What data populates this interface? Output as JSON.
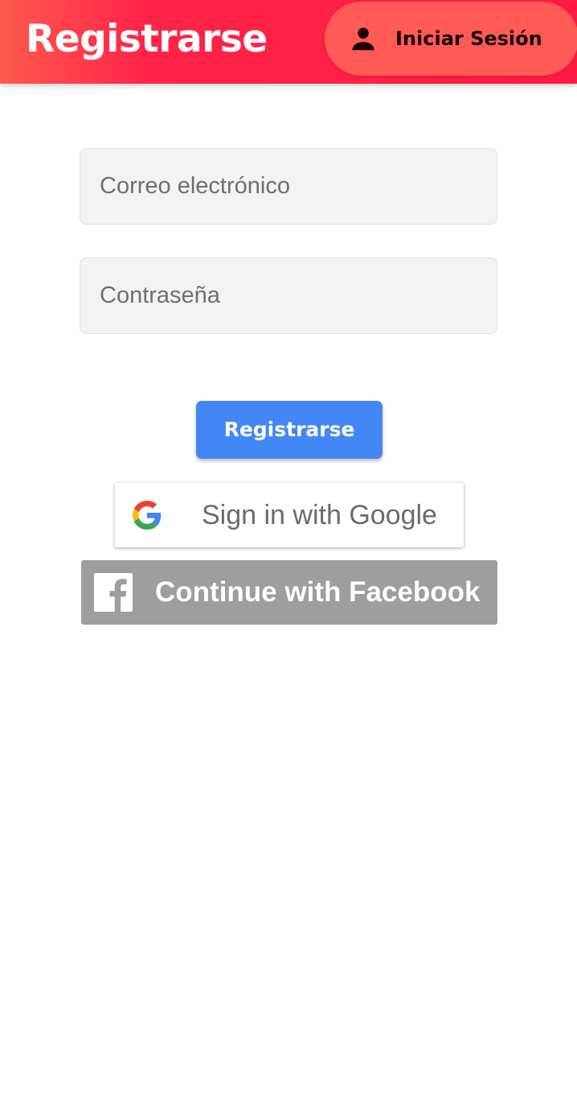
{
  "header": {
    "title": "Registrarse",
    "login_button": {
      "label": "Iniciar Sesión",
      "icon": "person-icon"
    }
  },
  "form": {
    "email": {
      "placeholder": "Correo electrónico",
      "value": ""
    },
    "password": {
      "placeholder": "Contraseña",
      "value": ""
    },
    "register_button_label": "Registrarse"
  },
  "social": {
    "google": {
      "label": "Sign in with Google",
      "icon": "google-icon"
    },
    "facebook": {
      "label": "Continue with Facebook",
      "icon": "facebook-icon"
    }
  },
  "colors": {
    "header_gradient_start": "#ff5a4e",
    "header_gradient_end": "#ff1a43",
    "login_pill": "#ff5a55",
    "register_button": "#4287f5",
    "facebook_button": "#9e9e9e",
    "field_background": "#f3f3f3"
  }
}
